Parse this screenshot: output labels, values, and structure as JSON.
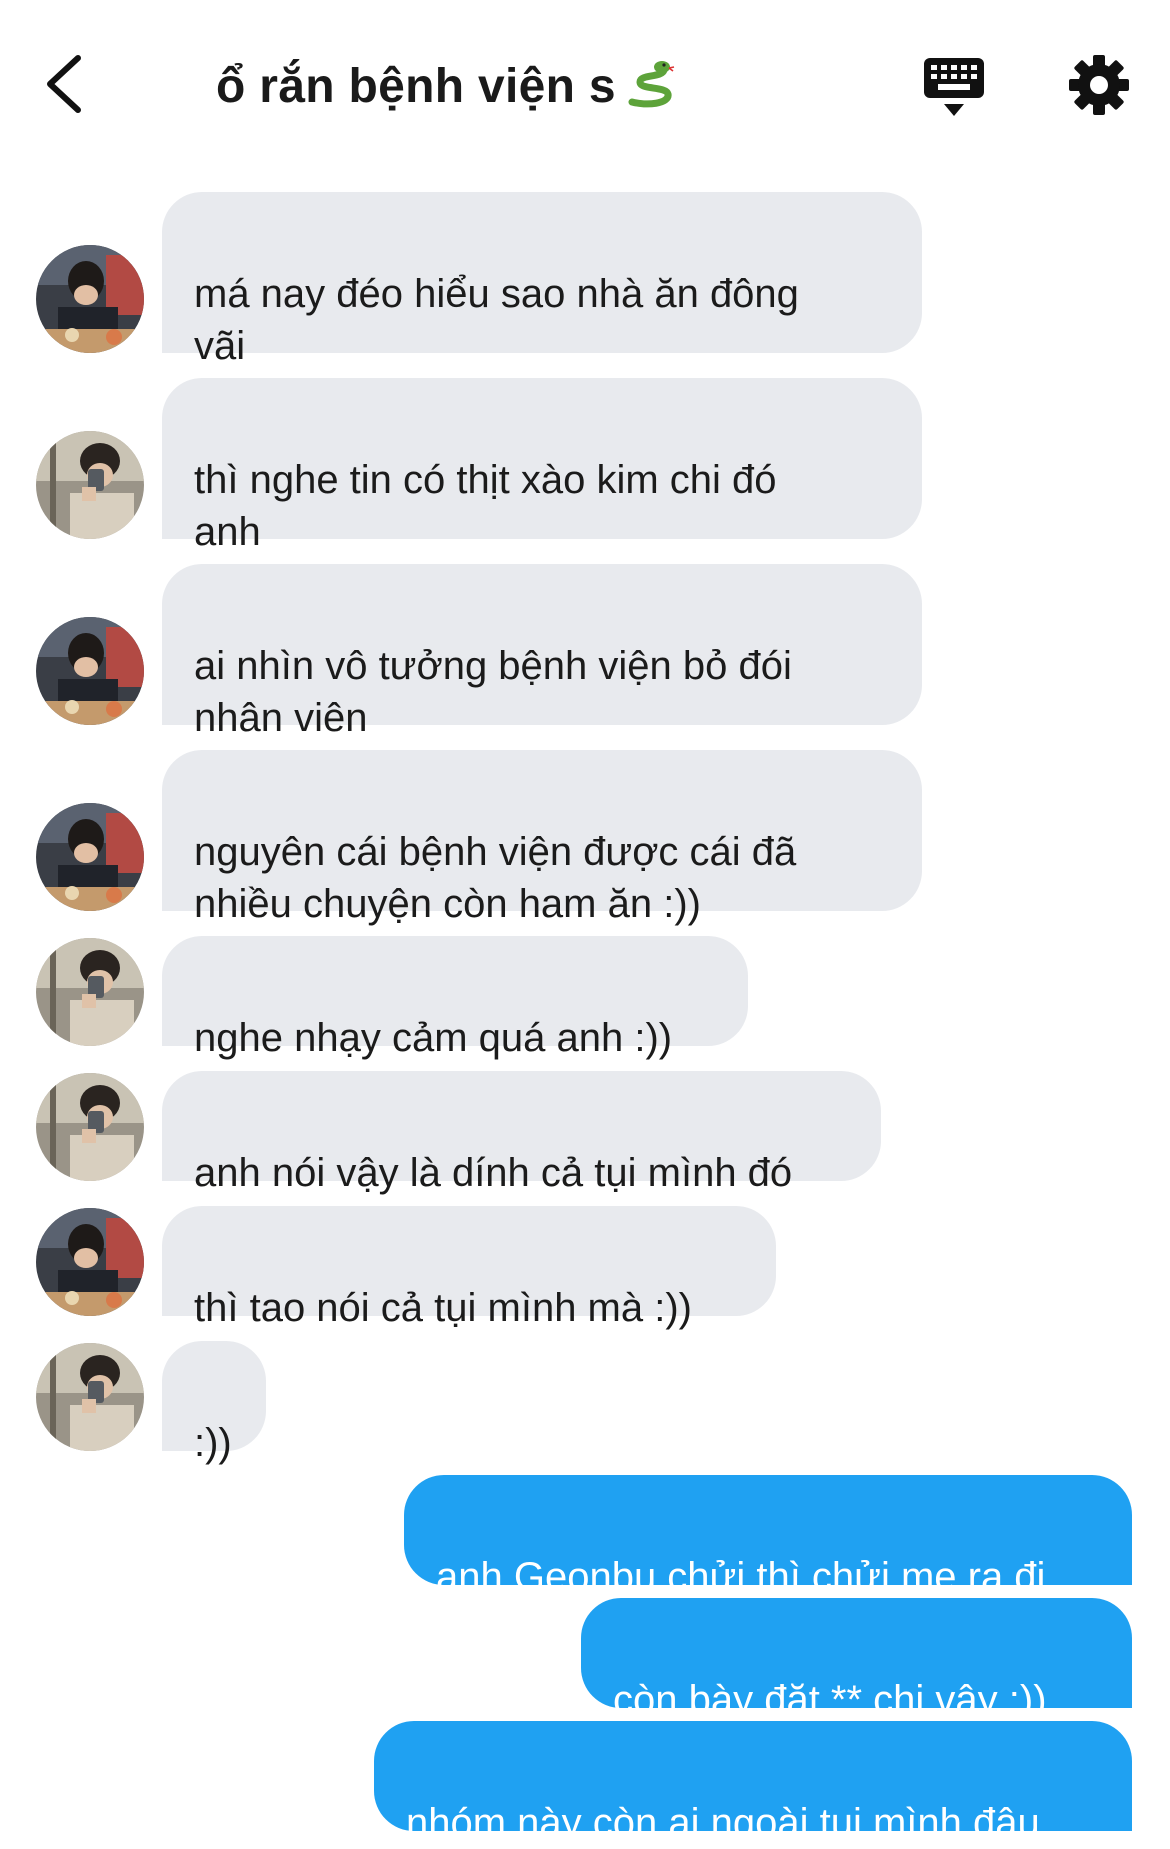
{
  "header": {
    "title": "ổ rắn bệnh viện s",
    "title_emoji": "snake-emoji"
  },
  "messages": [
    {
      "side": "in",
      "avatar": "avatar-a",
      "text": "má nay đéo hiểu sao nhà ăn đông\nvãi"
    },
    {
      "side": "in",
      "avatar": "avatar-b",
      "text": "thì nghe tin có thịt xào kim chi đó\nanh"
    },
    {
      "side": "in",
      "avatar": "avatar-a",
      "text": "ai nhìn vô tưởng bệnh viện bỏ đói\nnhân viên"
    },
    {
      "side": "in",
      "avatar": "avatar-a",
      "text": "nguyên cái bệnh viện được cái đã\nnhiều chuyện còn ham ăn :))"
    },
    {
      "side": "in",
      "avatar": "avatar-b",
      "text": "nghe nhạy cảm quá anh :))"
    },
    {
      "side": "in",
      "avatar": "avatar-b",
      "text": "anh nói vậy là dính cả tụi mình đó"
    },
    {
      "side": "in",
      "avatar": "avatar-a",
      "text": "thì tao nói cả tụi mình mà :))"
    },
    {
      "side": "in",
      "avatar": "avatar-b",
      "text": ":))"
    },
    {
      "side": "out",
      "text": "anh Geonbu chửi thì chửi mẹ ra đi"
    },
    {
      "side": "out",
      "text": "còn bày đặt ** chi vậy :))"
    },
    {
      "side": "out",
      "text": "nhóm này còn ai ngoài tụi mình đâu"
    }
  ],
  "colors": {
    "incoming_bubble": "#e8eaee",
    "outgoing_bubble": "#1fa1f2"
  }
}
